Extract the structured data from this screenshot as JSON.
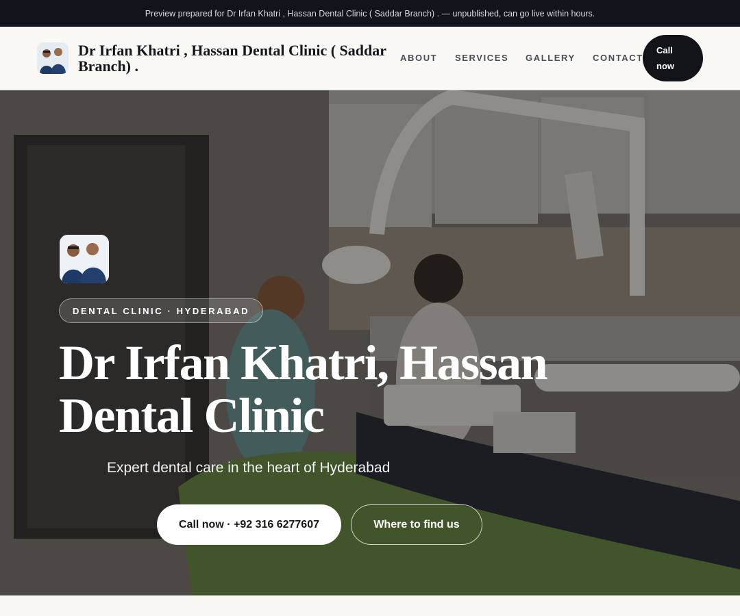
{
  "preview_banner": {
    "text": "Preview prepared for Dr Irfan Khatri , Hassan Dental Clinic ( Saddar Branch) . — unpublished, can go live within hours."
  },
  "navbar": {
    "brand_name": "Dr Irfan Khatri , Hassan Dental Clinic ( Saddar Branch) .",
    "links": [
      {
        "label": "ABOUT"
      },
      {
        "label": "SERVICES"
      },
      {
        "label": "GALLERY"
      },
      {
        "label": "CONTACT"
      }
    ],
    "call_label": "Call now"
  },
  "hero": {
    "badge": "DENTAL CLINIC · HYDERABAD",
    "title": "Dr Irfan Khatri, Hassan Dental Clinic",
    "subtitle": "Expert dental care in the heart of Hyderabad",
    "primary_cta": "Call now · +92 316 6277607",
    "secondary_cta": "Where to find us"
  },
  "icons": {
    "brand_logo": "doctors-photo-logo",
    "hero_logo": "doctors-photo-logo",
    "hero_background": "dental-clinic-photo"
  },
  "colors": {
    "topbar_bg": "#11141a",
    "nav_bg": "#f9f8f5",
    "call_button_bg": "#12141a",
    "hero_text": "#ffffff"
  }
}
